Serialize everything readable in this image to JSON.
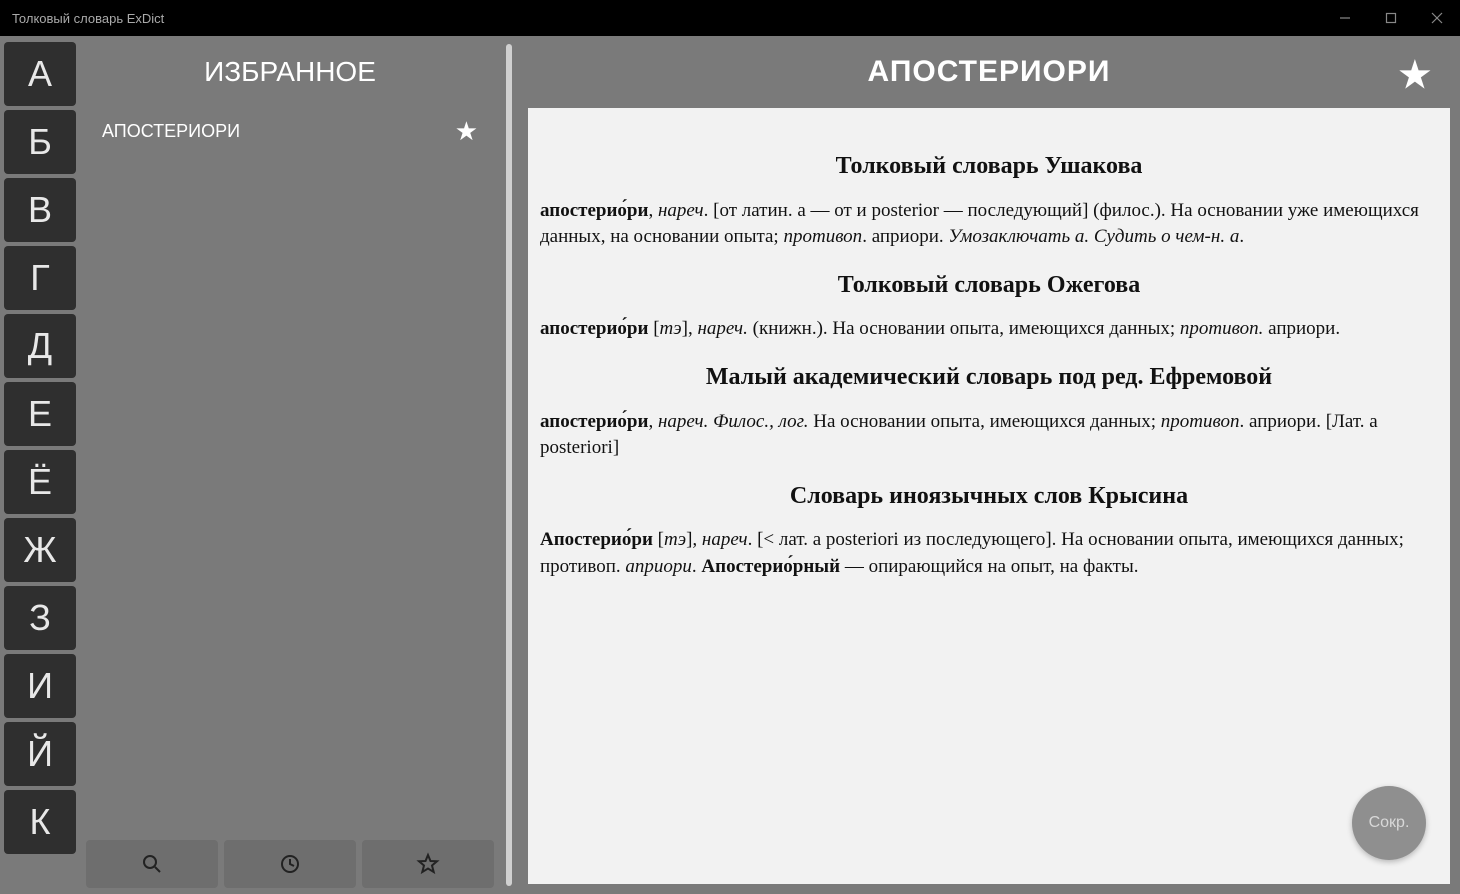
{
  "window": {
    "title": "Толковый словарь ExDict"
  },
  "alphabet": [
    "А",
    "Б",
    "В",
    "Г",
    "Д",
    "Е",
    "Ё",
    "Ж",
    "З",
    "И",
    "Й",
    "К"
  ],
  "left": {
    "header": "ИЗБРАННОЕ",
    "favorites": [
      {
        "word": "АПОСТЕРИОРИ"
      }
    ]
  },
  "right": {
    "title": "АПОСТЕРИОРИ",
    "sections": [
      {
        "heading": "Толковый словарь Ушакова",
        "html": "<span class='hw'>апостерио́ри</span>, <span class='it'>нареч</span>. [от латин. a — от и posterior — последующий] (филос.). На основании уже имеющихся данных, на основании опыта; <span class='it'>противоп</span>. априори. <span class='it'>Умозаключать а. Судить о чем-н. а</span>."
      },
      {
        "heading": "Толковый словарь Ожегова",
        "html": "<span class='hw'>апостерио́ри</span> [<span class='it'>тэ</span>], <span class='it'>нареч.</span> (книжн.). На основании опыта, имеющихся данных; <span class='it'>противоп.</span> априори."
      },
      {
        "heading": "Малый академический словарь под ред. Ефремовой",
        "html": "<span class='hw'>апостерио́ри</span>, <span class='it'>нареч. Филос., лог.</span> На основании опыта, имеющихся данных; <span class='it'>противоп</span>. априори. [Лат. a posteriori]"
      },
      {
        "heading": "Словарь иноязычных слов Крысина",
        "html": "<span class='hw'>Апостерио́ри</span> [<span class='it'>тэ</span>]<span class='it'>, нареч</span>. [< лат. a posteriori из последующего]. На основании опыта, имеющихся данных; противоп. <span class='it'>априори</span>. <span class='hw'>Апостерио́рный</span> — опирающийся на опыт, на факты."
      }
    ]
  },
  "fab": {
    "label": "Сокр."
  }
}
